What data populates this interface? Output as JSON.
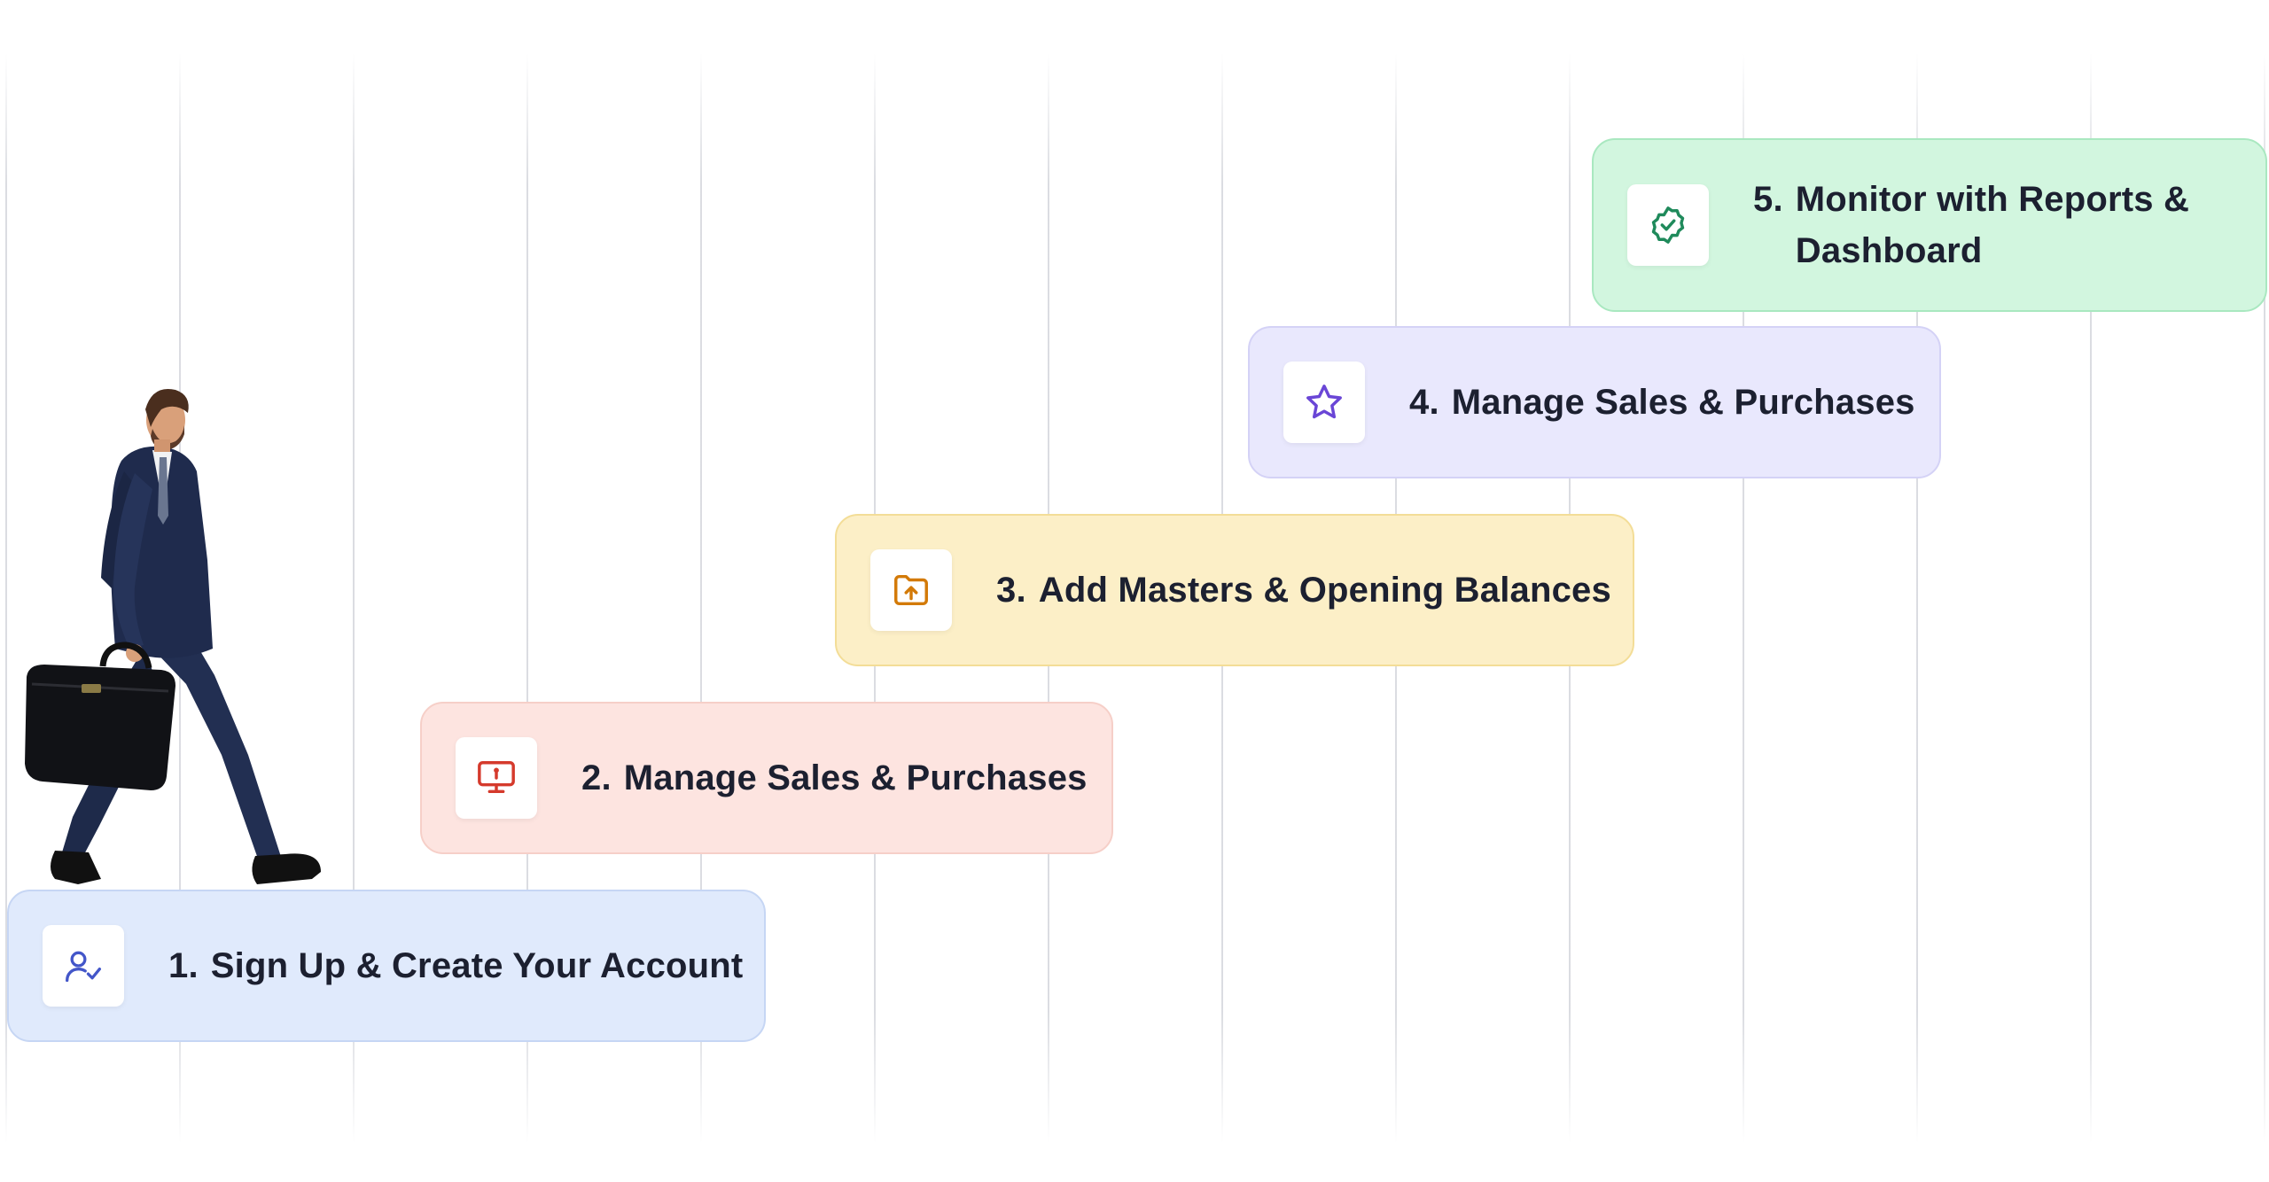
{
  "steps": [
    {
      "number": "1.",
      "label": "Sign Up & Create Your Account",
      "icon": "user-check-icon",
      "accent": "#4356c9",
      "bg": "#e0eafc"
    },
    {
      "number": "2.",
      "label": "Manage Sales & Purchases",
      "icon": "monitor-icon",
      "accent": "#d53a2c",
      "bg": "#fde4e0"
    },
    {
      "number": "3.",
      "label": "Add Masters & Opening Balances",
      "icon": "folder-upload-icon",
      "accent": "#d37a08",
      "bg": "#fcefc7"
    },
    {
      "number": "4.",
      "label": "Manage Sales & Purchases",
      "icon": "star-icon",
      "accent": "#6a46d6",
      "bg": "#e9e8fd"
    },
    {
      "number": "5.",
      "label": "Monitor with Reports & Dashboard",
      "icon": "badge-check-icon",
      "accent": "#1f8a5b",
      "bg": "#d2f6df"
    }
  ],
  "illustration": {
    "subject": "businessman-walking-with-briefcase"
  }
}
